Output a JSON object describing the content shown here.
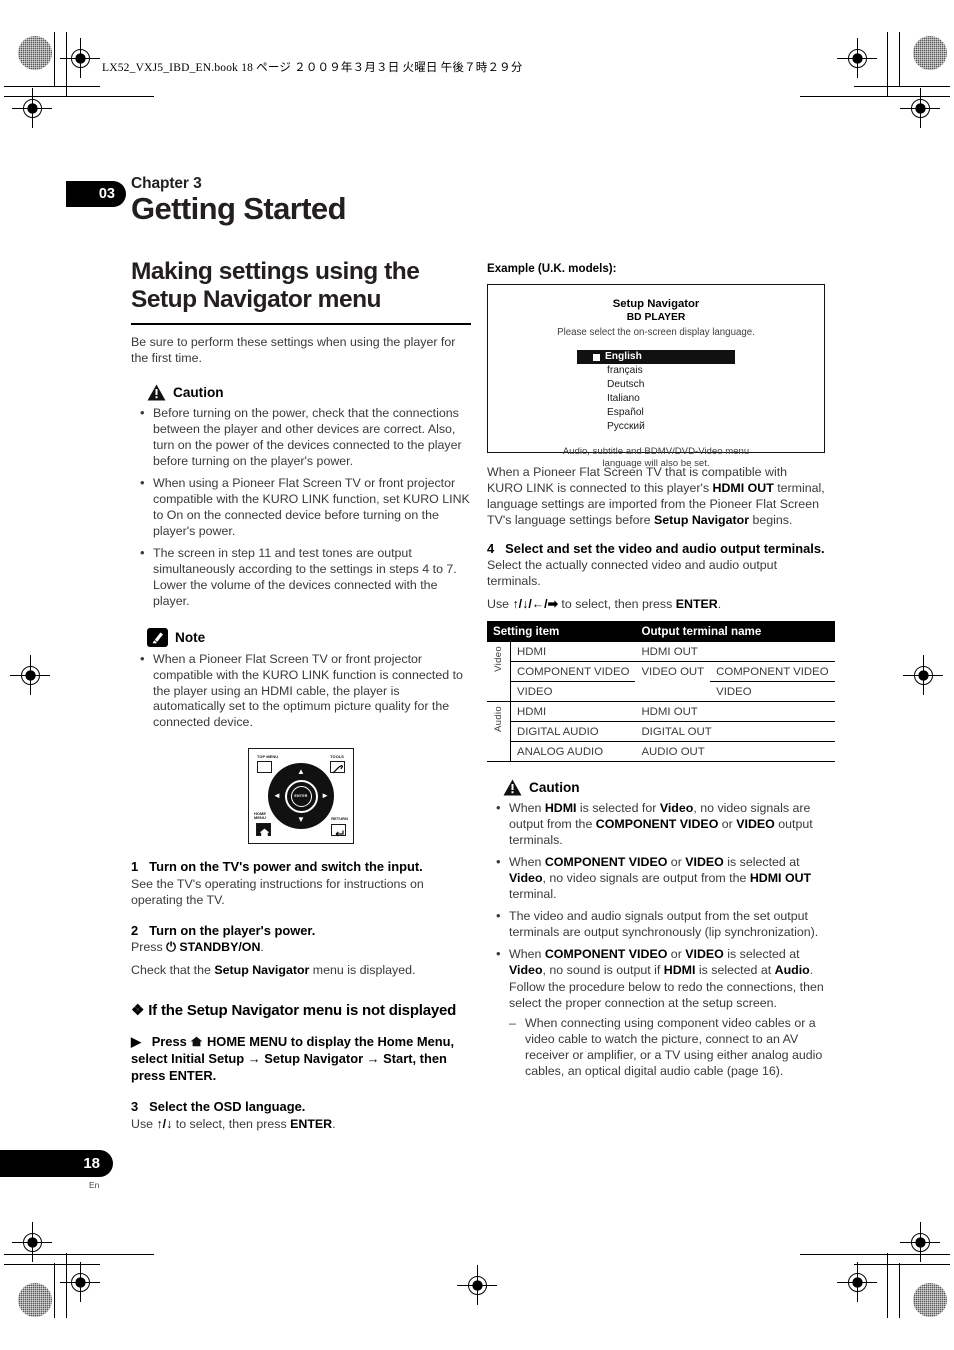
{
  "page": {
    "running_header": "LX52_VXJ5_IBD_EN.book   18 ページ   ２００９年３月３日   火曜日   午後７時２９分",
    "chapter_number": "03",
    "page_number": "18",
    "page_language_code": "En"
  },
  "left": {
    "chapter_label": "Chapter 3",
    "chapter_title": "Getting Started",
    "section_title": "Making settings using the Setup Navigator menu",
    "intro": "Be sure to perform these settings when using the player for the first time.",
    "caution": {
      "title": "Caution",
      "icon": "warning-triangle-icon",
      "items": [
        "Before turning on the power, check that the connections between the player and other devices are correct. Also, turn on the power of the devices connected to the player before turning on the player's power.",
        "When using a Pioneer Flat Screen TV or front projector compatible with the KURO LINK function, set KURO LINK to On on the connected device before turning on the player's power.",
        "The screen in step 11 and test tones are output simultaneously according to the settings in steps 4 to 7. Lower the volume of the devices connected with the player."
      ]
    },
    "note": {
      "title": "Note",
      "icon": "pencil-note-icon",
      "items": [
        "When a Pioneer Flat Screen TV or front projector compatible with the KURO LINK function is connected to the player using an HDMI cable, the player is automatically set to the optimum picture quality for the connected device."
      ]
    },
    "remote": {
      "top_menu_label": "TOP MENU",
      "tools_label": "TOOLS",
      "home_menu_label": "HOME MENU",
      "return_label": "RETURN",
      "enter_label": "ENTER",
      "arrow_up": "▲",
      "arrow_down": "▼",
      "arrow_left": "◄",
      "arrow_right": "►",
      "home_icon": "home-icon",
      "tools_icon": "wrench-icon",
      "return_icon": "return-arrow-icon"
    },
    "steps": [
      {
        "num": "1",
        "head": "Turn on the TV's power and switch the input.",
        "body": "See the TV's operating instructions for instructions on operating the TV."
      },
      {
        "num": "2",
        "head": "Turn on the player's power.",
        "body_pre": "Press ",
        "body_symbol": "⏻",
        "body_bold": "STANDBY/ON",
        "body_post": ".",
        "body2_pre": "Check that the ",
        "body2_bold": "Setup Navigator",
        "body2_post": " menu is displayed."
      }
    ],
    "subhead": {
      "bullet": "❖",
      "text": "If the Setup Navigator menu is not displayed"
    },
    "arrow_step": {
      "marker": "▶",
      "pre": "Press ",
      "home_icon": "home-icon",
      "text": " HOME MENU to display the Home Menu, select Initial Setup → Setup Navigator → Start, then press ENTER."
    },
    "step3": {
      "num": "3",
      "head": "Select the OSD language.",
      "body_pre": "Use ",
      "body_arrows": "↑/↓",
      "body_mid": " to select, then press ",
      "body_bold": "ENTER",
      "body_post": "."
    }
  },
  "right": {
    "example_label": "Example (U.K. models):",
    "osd": {
      "title": "Setup Navigator",
      "subtitle": "BD PLAYER",
      "instruction": "Please select the on-screen display language.",
      "languages": [
        "English",
        "français",
        "Deutsch",
        "Italiano",
        "Español",
        "Русский"
      ],
      "selected": "English",
      "footer_line1": "Audio, subtitle and BDMV/DVD-Video menu",
      "footer_line2": "language will also be set."
    },
    "kuro_paragraph": {
      "p1": "When a Pioneer Flat Screen TV that is compatible with KURO LINK is connected to this player's ",
      "b1": "HDMI OUT",
      "p2": " terminal, language settings are imported from the Pioneer Flat Screen TV's language settings before ",
      "b2": "Setup Navigator",
      "p3": " begins."
    },
    "step4": {
      "num": "4",
      "head": "Select and set the video and audio output terminals.",
      "body": "Select the actually connected video and audio output terminals.",
      "use_pre": "Use ",
      "use_arrows": "↑/↓/←/➡",
      "use_mid": " to select, then press ",
      "use_bold": "ENTER",
      "use_post": "."
    },
    "table": {
      "headers": [
        "Setting item",
        "Output terminal name"
      ],
      "groups": [
        {
          "label": "Video",
          "rows": [
            {
              "item": "HDMI",
              "terminal": "HDMI OUT",
              "extra": ""
            },
            {
              "item": "COMPONENT VIDEO",
              "terminal": "VIDEO OUT",
              "extra": "COMPONENT VIDEO"
            },
            {
              "item": "VIDEO",
              "terminal": "",
              "extra": "VIDEO"
            }
          ]
        },
        {
          "label": "Audio",
          "rows": [
            {
              "item": "HDMI",
              "terminal": "HDMI OUT",
              "extra": ""
            },
            {
              "item": "DIGITAL AUDIO",
              "terminal": "DIGITAL OUT",
              "extra": ""
            },
            {
              "item": "ANALOG AUDIO",
              "terminal": "AUDIO OUT",
              "extra": ""
            }
          ]
        }
      ]
    },
    "caution": {
      "title": "Caution",
      "icon": "warning-triangle-icon",
      "item1": {
        "p1": "When ",
        "b1": "HDMI",
        "p2": " is selected for ",
        "b2": "Video",
        "p3": ", no video signals are output from the ",
        "b3": "COMPONENT VIDEO",
        "p4": " or ",
        "b4": "VIDEO",
        "p5": " output terminals."
      },
      "item2": {
        "p1": "When ",
        "b1": "COMPONENT VIDEO",
        "p2": " or ",
        "b2": "VIDEO",
        "p3": " is selected at ",
        "b3": "Video",
        "p4": ", no video signals are output from the ",
        "b4": "HDMI OUT",
        "p5": " terminal."
      },
      "item3": "The video and audio signals output from the set output terminals are output synchronously (lip synchronization).",
      "item4": {
        "p1": "When ",
        "b1": "COMPONENT VIDEO",
        "p2": " or ",
        "b2": "VIDEO",
        "p3": " is selected at ",
        "b3": "Video",
        "p4": ", no sound is output if ",
        "b4": "HDMI",
        "p5": " is selected at ",
        "b5": "Audio",
        "p6": ".",
        "follow": "Follow the procedure below to redo the connections, then select the proper connection at the setup screen.",
        "dash": "When connecting using component video cables or a video cable to watch the picture, connect to an AV receiver or amplifier, or a TV using either analog audio cables, an optical digital audio cable (page 16)."
      }
    }
  }
}
